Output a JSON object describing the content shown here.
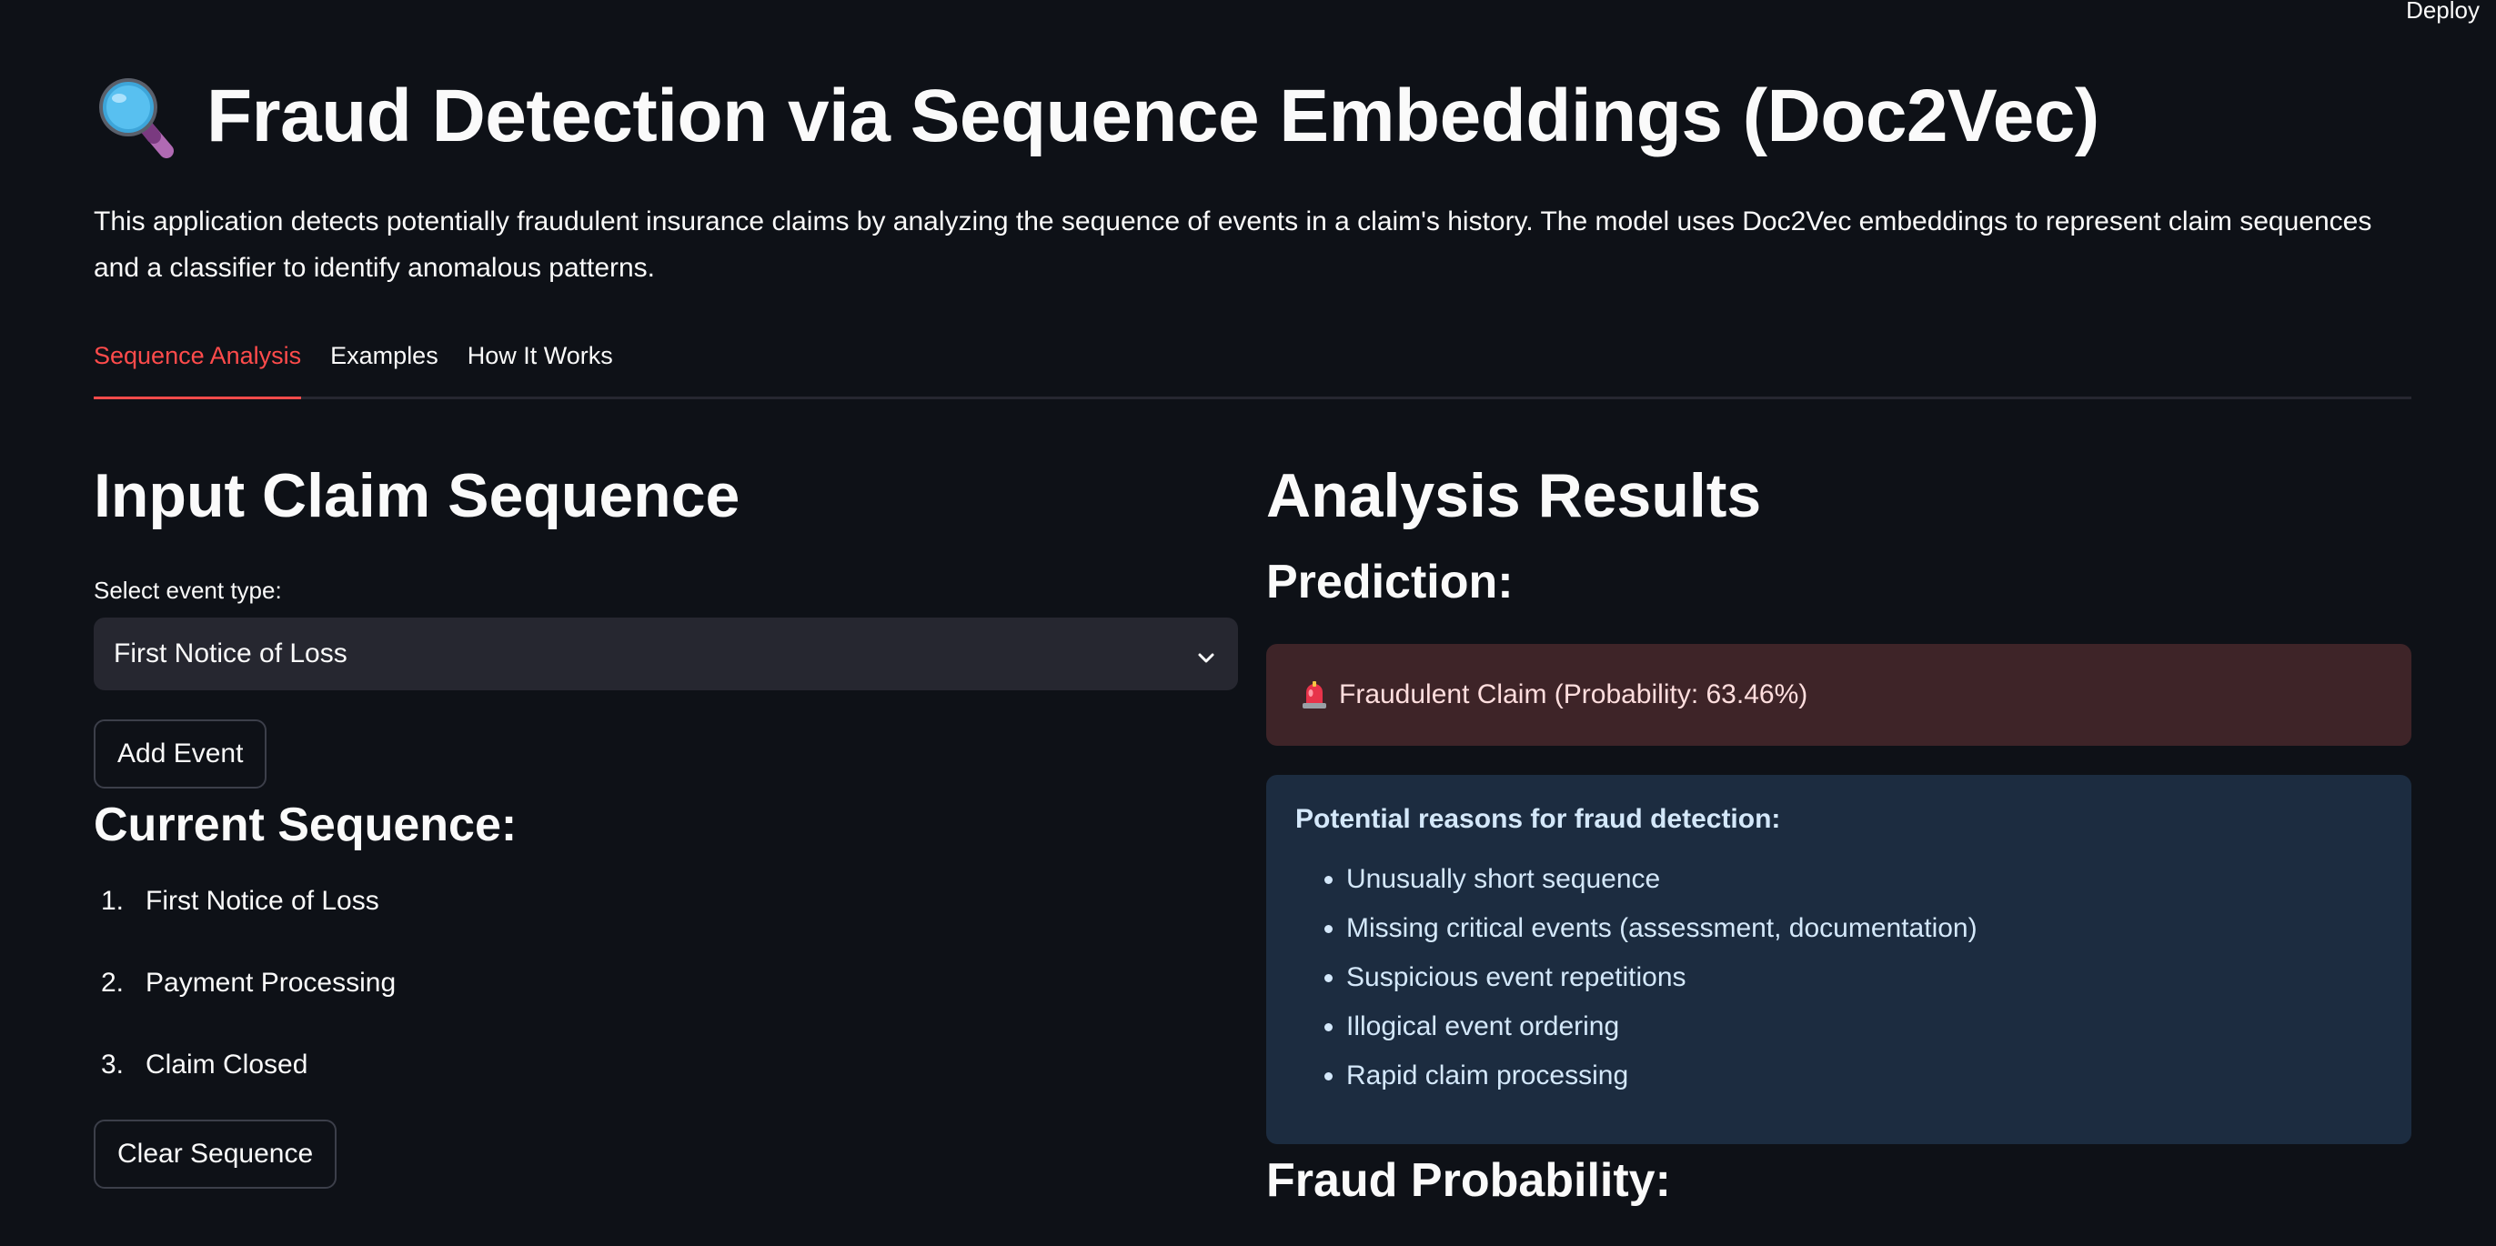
{
  "toolbar": {
    "deploy_label": "Deploy"
  },
  "header": {
    "icon": "magnifying-glass-icon",
    "title": "Fraud Detection via Sequence Embeddings (Doc2Vec)"
  },
  "intro": {
    "text": "This application detects potentially fraudulent insurance claims by analyzing the sequence of events in a claim's history. The model uses Doc2Vec embeddings to represent claim sequences and a classifier to identify anomalous patterns."
  },
  "tabs": [
    {
      "label": "Sequence Analysis",
      "active": true
    },
    {
      "label": "Examples",
      "active": false
    },
    {
      "label": "How It Works",
      "active": false
    }
  ],
  "input": {
    "title": "Input Claim Sequence",
    "select_label": "Select event type:",
    "select_value": "First Notice of Loss",
    "add_button": "Add Event"
  },
  "sequence": {
    "title": "Current Sequence:",
    "items": [
      {
        "num": "1.",
        "label": "First Notice of Loss"
      },
      {
        "num": "2.",
        "label": "Payment Processing"
      },
      {
        "num": "3.",
        "label": "Claim Closed"
      }
    ],
    "clear_button": "Clear Sequence"
  },
  "results": {
    "title": "Analysis Results",
    "prediction_title": "Prediction:",
    "alert_icon": "siren-icon",
    "alert_text": "Fraudulent Claim (Probability: 63.46%)",
    "reasons_title": "Potential reasons for fraud detection:",
    "reasons": [
      "Unusually short sequence",
      "Missing critical events (assessment, documentation)",
      "Suspicious event repetitions",
      "Illogical event ordering",
      "Rapid claim processing"
    ],
    "fraud_prob_title": "Fraud Probability:"
  },
  "colors": {
    "background": "#0e1117",
    "accent": "#ff4b4b",
    "alert_bg": "#3e2428",
    "info_bg": "#1c2c40",
    "select_bg": "#262730"
  }
}
